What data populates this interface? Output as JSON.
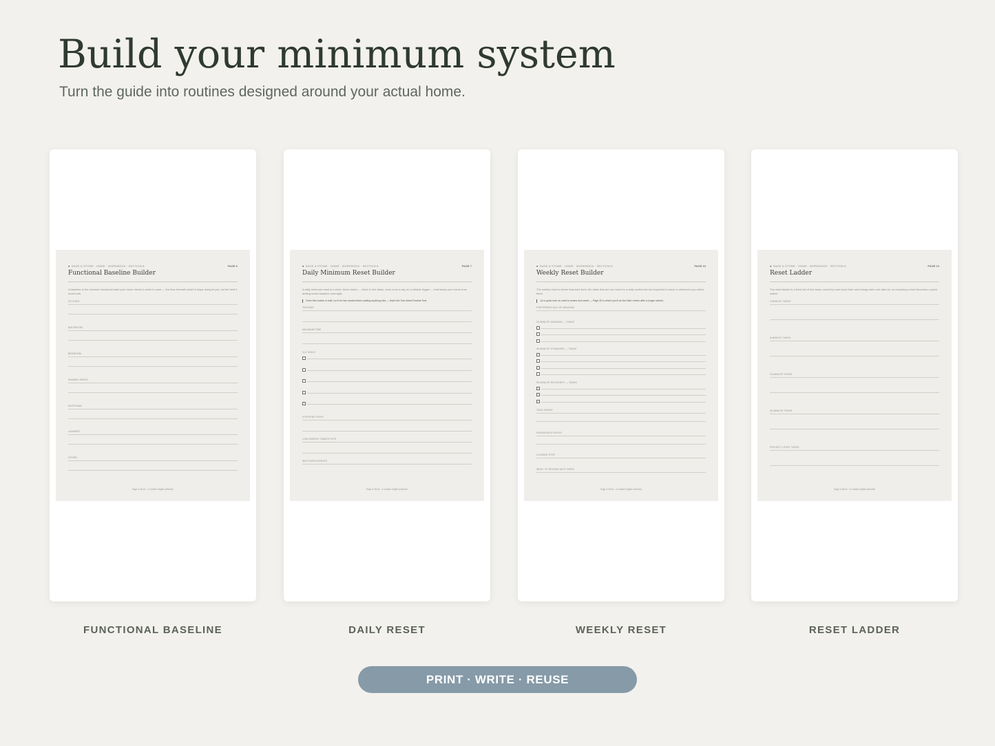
{
  "header": {
    "title": "Build your minimum system",
    "subtitle": "Turn the guide into routines designed around your actual home."
  },
  "cards": [
    {
      "caption": "FUNCTIONAL BASELINE",
      "crumbs": [
        "SAGE & STONE",
        "HOME",
        "WORKBOOK",
        "SECTION 8"
      ],
      "page": "PAGE 6",
      "title": "Functional Baseline Builder",
      "intro": "A baseline is the minimum functional state your home needs in order to work — the floor beneath which it stops doing its job, not the best it could look.",
      "note": "",
      "fields": [
        {
          "label": "KITCHEN"
        },
        {
          "label": "BATHROOM"
        },
        {
          "label": "BEDROOM"
        },
        {
          "label": "SHARED SPACE"
        },
        {
          "label": "ENTRYWAY"
        },
        {
          "label": "LAUNDRY"
        },
        {
          "label": "OTHER"
        }
      ],
      "footer": "Sage & Stone  ·  a Caldare Digital collection"
    },
    {
      "caption": "DAILY RESET",
      "crumbs": [
        "SAGE & STONE",
        "HOME",
        "WORKBOOK",
        "SECTION 8"
      ],
      "page": "PAGE 7",
      "title": "Daily Minimum Reset Builder",
      "intro": "A daily minimum reset is a short, fixed routine — three to five tasks, done once a day on a reliable trigger — that keeps your home from drifting below baseline overnight.",
      "note": "Once this routine is built, run it for two weeks before adding anything else — that's the Two-Week Routine Test.",
      "fields": [
        {
          "label": "TRIGGER"
        },
        {
          "label": "MAXIMUM TIME"
        },
        {
          "label": "3–5 TASKS"
        },
        {
          "label": "STOPPING POINT"
        },
        {
          "label": "LOW-ENERGY SUBSTITUTE"
        },
        {
          "label": "WHO PARTICIPATES"
        }
      ],
      "footer": "Sage & Stone  ·  a Caldare Digital collection"
    },
    {
      "caption": "WEEKLY RESET",
      "crumbs": [
        "SAGE & STONE",
        "HOME",
        "WORKBOOK",
        "SECTION 8"
      ],
      "page": "PAGE 10",
      "title": "Weekly Reset Builder",
      "intro": "The weekly reset is where that work lives: the tasks that are too much for a daily routine but too important to leave to whenever you notice them.",
      "note": "Jot a quick note on what to review next week — Page 30 is where you'll do the fuller review after a longer stretch.",
      "fields": [
        {
          "label": "PREFERRED DAY OR WINDOW"
        },
        {
          "label": "20-MINUTE MINIMUM — TASKS"
        },
        {
          "label": "45-MINUTE STANDARD — TASKS"
        },
        {
          "label": "90-MINUTE RECOVERY — TASKS"
        },
        {
          "label": "TASK ORDER"
        },
        {
          "label": "HOUSEHOLD ROLES"
        },
        {
          "label": "CLOSING STEP"
        },
        {
          "label": "WHAT TO REVIEW NEXT WEEK"
        }
      ],
      "footer": "Sage & Stone  ·  a Caldare Digital collection"
    },
    {
      "caption": "RESET LADDER",
      "crumbs": [
        "SAGE & STONE",
        "HOME",
        "WORKBOOK",
        "SECTION 8"
      ],
      "page": "PAGE 13",
      "title": "Reset Ladder",
      "intro": "The reset ladder is a fixed set of five tasks, sorted by how much time and energy each one asks for, so choosing a reset becomes a quick match.",
      "note": "",
      "fields": [
        {
          "label": "2-MINUTE TASKS"
        },
        {
          "label": "5-MINUTE TASKS"
        },
        {
          "label": "15-MINUTE TASKS"
        },
        {
          "label": "30-MINUTE TASKS"
        },
        {
          "label": "PROJECT-LEVEL TASKS"
        }
      ],
      "footer": "Sage & Stone  ·  a Caldare Digital collection"
    }
  ],
  "cta": {
    "label": "PRINT · WRITE · REUSE"
  },
  "colors": {
    "background": "#f2f1ed",
    "accent": "#869aa8",
    "heading": "#2f3a30"
  }
}
